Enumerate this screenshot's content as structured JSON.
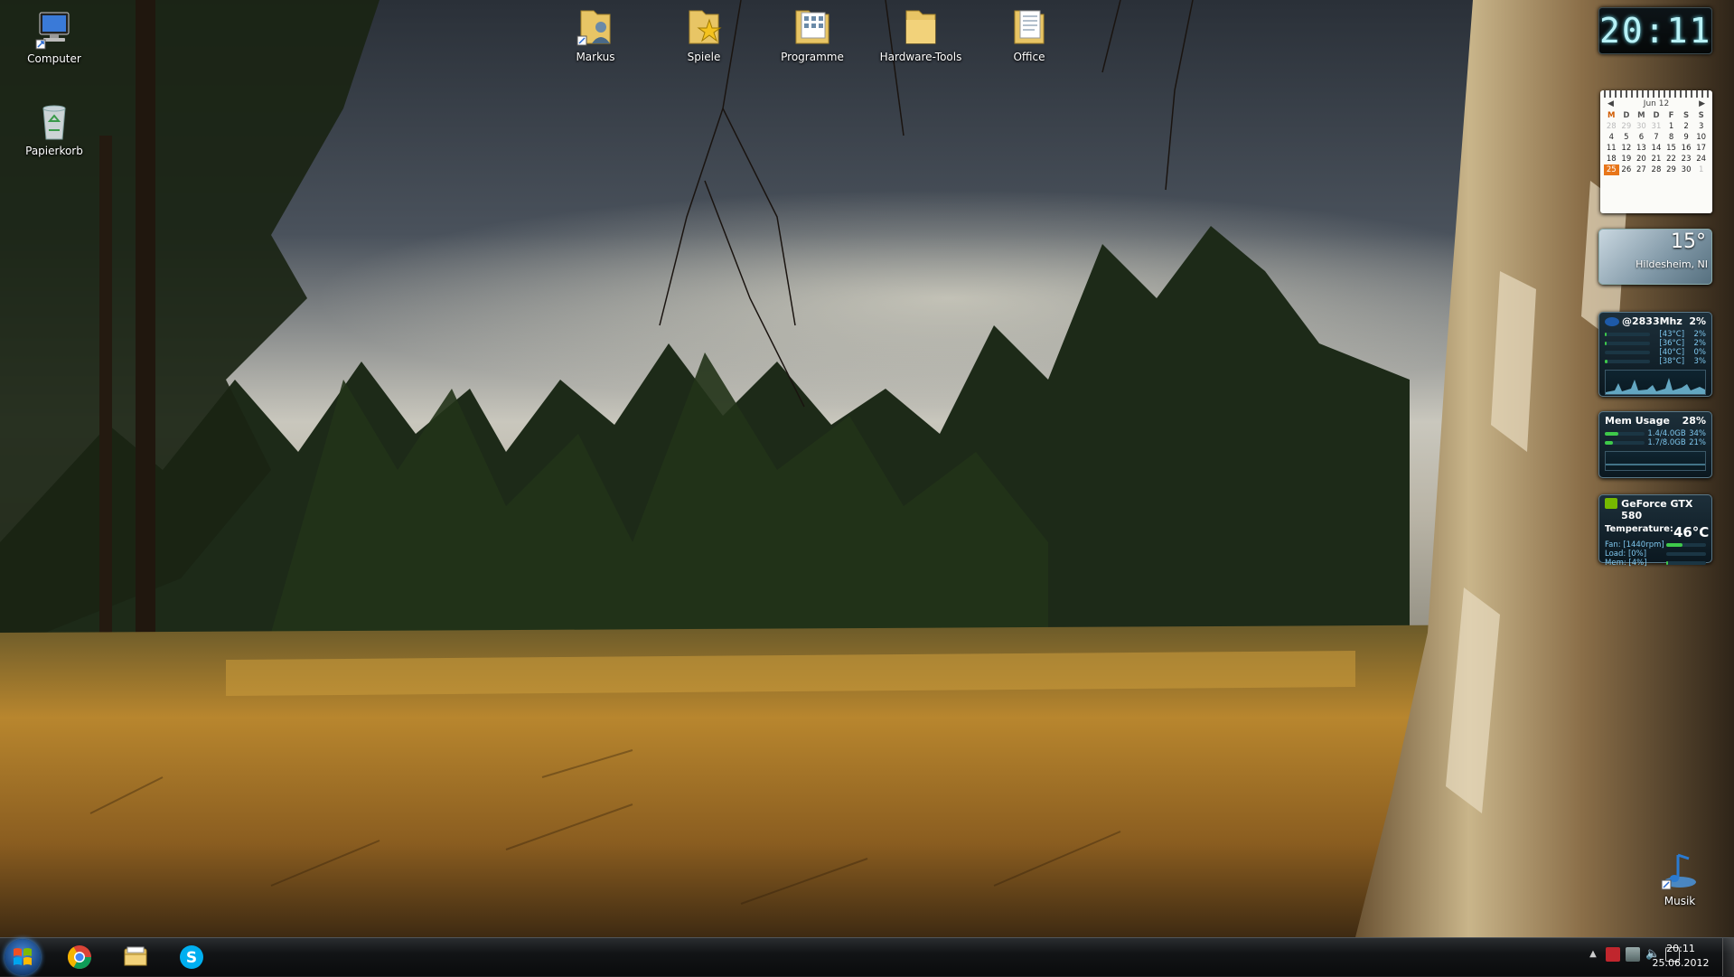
{
  "desktop": {
    "icons_left": [
      {
        "label": "Computer",
        "icon": "computer-icon"
      },
      {
        "label": "Papierkorb",
        "icon": "recycle-bin-icon"
      }
    ],
    "icons_top": [
      {
        "label": "Markus",
        "icon": "user-folder-icon"
      },
      {
        "label": "Spiele",
        "icon": "games-folder-icon"
      },
      {
        "label": "Programme",
        "icon": "programs-folder-icon"
      },
      {
        "label": "Hardware-Tools",
        "icon": "folder-icon"
      },
      {
        "label": "Office",
        "icon": "office-folder-icon"
      }
    ],
    "icon_bottom_right": {
      "label": "Musik",
      "icon": "music-icon"
    }
  },
  "gadgets": {
    "clock": {
      "time": "20:11"
    },
    "calendar": {
      "month": "Jun 12",
      "weekdays": [
        "M",
        "D",
        "M",
        "D",
        "F",
        "S",
        "S"
      ],
      "weeks": [
        [
          "28",
          "29",
          "30",
          "31",
          "1",
          "2",
          "3"
        ],
        [
          "4",
          "5",
          "6",
          "7",
          "8",
          "9",
          "10"
        ],
        [
          "11",
          "12",
          "13",
          "14",
          "15",
          "16",
          "17"
        ],
        [
          "18",
          "19",
          "20",
          "21",
          "22",
          "23",
          "24"
        ],
        [
          "25",
          "26",
          "27",
          "28",
          "29",
          "30",
          "1"
        ]
      ],
      "today": "25"
    },
    "weather": {
      "temperature": "15°",
      "location": "Hildesheim, NI"
    },
    "cpu": {
      "title": "@2833Mhz",
      "usage": "2%",
      "cores": [
        {
          "temp": "[43°C]",
          "load": "2%"
        },
        {
          "temp": "[36°C]",
          "load": "2%"
        },
        {
          "temp": "[40°C]",
          "load": "0%"
        },
        {
          "temp": "[38°C]",
          "load": "3%"
        }
      ]
    },
    "mem": {
      "title": "Mem Usage",
      "usage": "28%",
      "rows": [
        {
          "text": "1.4/4.0GB",
          "pct": "34%"
        },
        {
          "text": "1.7/8.0GB",
          "pct": "21%"
        }
      ]
    },
    "gpu": {
      "title": "GeForce GTX 580",
      "temp_label": "Temperature:",
      "temp_value": "46°C",
      "fan": "Fan: [1440rpm]",
      "load": "Load: [0%]",
      "mem": "Mem: [4%]"
    }
  },
  "taskbar": {
    "pinned": [
      {
        "name": "chrome",
        "icon": "chrome-icon"
      },
      {
        "name": "explorer",
        "icon": "explorer-icon"
      },
      {
        "name": "skype",
        "icon": "skype-icon"
      }
    ],
    "clock_time": "20:11",
    "clock_date": "25.06.2012"
  },
  "colors": {
    "taskbar": "#0a0b0c",
    "clock_text": "#b8f1f6",
    "today_highlight": "#e8761a"
  }
}
